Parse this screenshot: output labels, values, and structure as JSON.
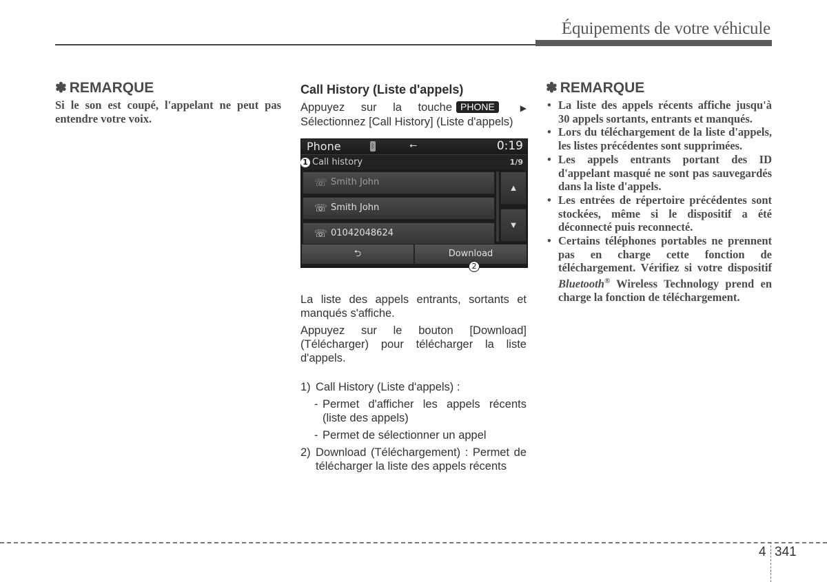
{
  "header": {
    "title": "Équipements de votre véhicule"
  },
  "left_note": {
    "asterisk": "✽",
    "heading": "REMARQUE",
    "text": "Si le son est coupé, l'appelant ne peut pas entendre votre voix."
  },
  "middle": {
    "section_title": "Call History (Liste d'appels)",
    "intro_before": "Appuyez sur la touche",
    "key_label": "PHONE",
    "intro_arrow": "▶",
    "intro_after": "Sélectionnez [Call History] (Liste d'appels)",
    "screen": {
      "title": "Phone",
      "bluetooth_icon": "bluetooth-icon",
      "usb_icon": "usb-icon",
      "usb_glyph": "⭠",
      "time": "0:19",
      "callout_1": "1",
      "sub_label": "Call history",
      "page": "1/9",
      "rows": [
        {
          "icon": "outgoing-call-icon",
          "glyph": "☏",
          "name": "Smith John",
          "dimmed": true
        },
        {
          "icon": "incoming-call-icon",
          "glyph": "☏",
          "name": "Smith John",
          "dimmed": false
        },
        {
          "icon": "outgoing-call-icon",
          "glyph": "☏",
          "name": "01042048624",
          "dimmed": false
        }
      ],
      "scroll_up_glyph": "▲",
      "scroll_down_glyph": "▼",
      "back_glyph": "⮌",
      "download_label": "Download",
      "callout_2": "2"
    },
    "para1": "La liste des appels entrants, sortants et manqués s'affiche.",
    "para2": "Appuyez sur le bouton [Download] (Télécharger) pour télécharger la liste d'appels.",
    "list": [
      {
        "num": "1)",
        "text": "Call History (Liste d'appels) :",
        "subs": [
          "Permet d'afficher les appels récents (liste des appels)",
          "Permet de sélectionner un appel"
        ]
      },
      {
        "num": "2)",
        "text": "Download (Téléchargement) : Permet de télécharger la liste des appels récents",
        "subs": []
      }
    ]
  },
  "right_note": {
    "asterisk": "✽",
    "heading": "REMARQUE",
    "bullets": [
      "La liste des appels récents affiche jusqu'à 30 appels sortants, entrants et manqués.",
      "Lors du téléchargement de la liste d'appels, les listes précédentes sont supprimées.",
      "Les appels entrants portant des ID d'appelant masqué ne sont pas sauvegardés dans la liste d'appels.",
      "Les entrées de répertoire précédentes sont stockées, même si le dispositif a été déconnecté puis reconnecté."
    ],
    "last_bullet_before": "Certains téléphones portables ne prennent pas en charge cette fonction de téléchargement. Vérifiez si votre dispositif",
    "last_bullet_italic": "Bluetooth",
    "last_bullet_reg": "®",
    "last_bullet_after": "Wireless Technology prend en charge la fonction de téléchargement."
  },
  "footer": {
    "chapter": "4",
    "page": "341"
  }
}
